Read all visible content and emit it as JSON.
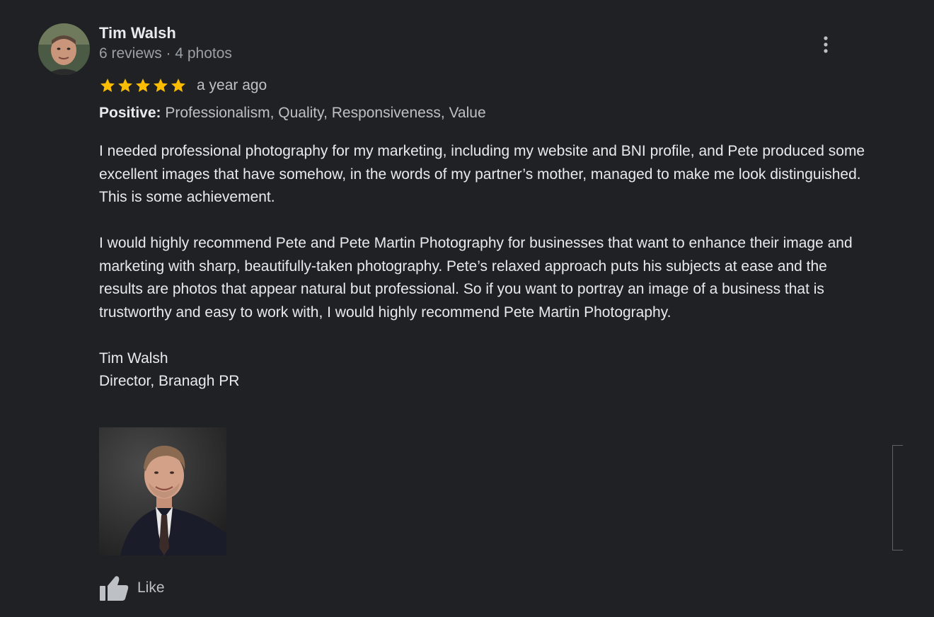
{
  "review": {
    "reviewer": {
      "name": "Tim Walsh",
      "meta": "6 reviews · 4 photos",
      "avatar_icon": "reviewer-avatar"
    },
    "more_icon": "more-vert-icon",
    "rating": {
      "stars": 5,
      "max_stars": 5,
      "star_color": "#fbbc04",
      "date": "a year ago"
    },
    "attributes": {
      "label": "Positive:",
      "value": "Professionalism, Quality, Responsiveness, Value"
    },
    "text": {
      "paragraph1": "I needed professional photography for my marketing, including my website and BNI profile, and Pete produced some excellent images that have somehow, in the words of my partner’s mother, managed to make me look distinguished. This is some achievement.",
      "paragraph2": "I would highly recommend Pete and Pete Martin Photography for businesses that want to enhance their image and marketing with sharp, beautifully-taken photography. Pete’s relaxed approach puts his subjects at ease and the results are photos that appear natural but professional. So if you want to portray an image of a business that is trustworthy and easy to work with, I would highly recommend Pete Martin Photography.",
      "signature_name": "Tim Walsh",
      "signature_title": "Director, Branagh PR"
    },
    "photo_icon": "review-photo",
    "like": {
      "label": "Like",
      "icon": "thumb-up-icon"
    }
  },
  "colors": {
    "background": "#202124",
    "primary_text": "#e8eaed",
    "secondary_text": "#9aa0a6",
    "star": "#fbbc04"
  }
}
